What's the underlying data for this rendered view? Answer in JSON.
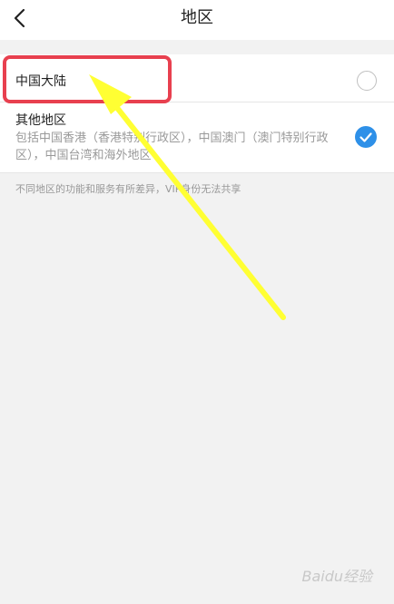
{
  "header": {
    "title": "地区"
  },
  "options": [
    {
      "label": "中国大陆",
      "selected": false
    },
    {
      "label": "其他地区",
      "description": "包括中国香港（香港特别行政区），中国澳门（澳门特别行政区），中国台湾和海外地区",
      "selected": true
    }
  ],
  "footnote": "不同地区的功能和服务有所差异，VIP身份无法共享",
  "annotations": {
    "highlight_color": "#e8404f",
    "arrow_color": "#ffff33"
  },
  "watermark": "Baidu经验",
  "colors": {
    "accent": "#2e90e8",
    "background": "#f2f2f2"
  }
}
